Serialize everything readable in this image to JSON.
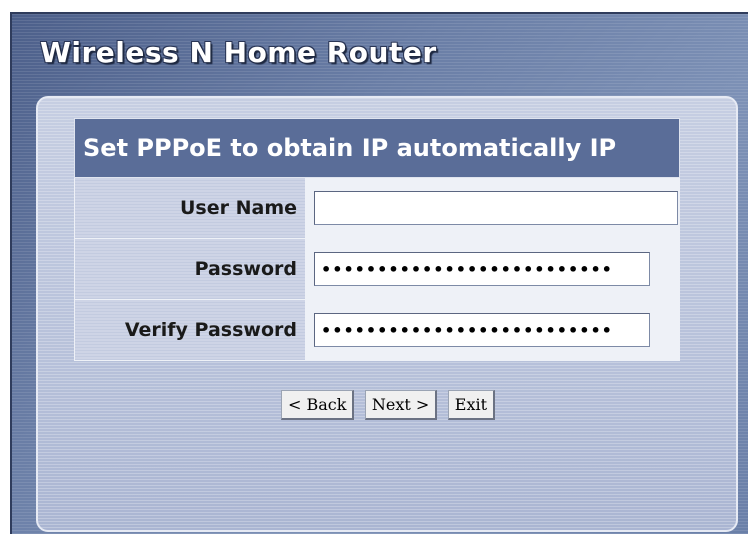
{
  "app": {
    "title": "Wireless N Home Router"
  },
  "form": {
    "heading": "Set PPPoE to obtain IP automatically IP",
    "fields": [
      {
        "label": "User Name",
        "value": "",
        "type": "text"
      },
      {
        "label": "Password",
        "value": "••••••••••••••••••••••••••",
        "type": "password"
      },
      {
        "label": "Verify Password",
        "value": "••••••••••••••••••••••••••",
        "type": "password"
      }
    ]
  },
  "buttons": {
    "back_label": "< Back",
    "next_label": "Next >",
    "exit_label": "Exit"
  },
  "colors": {
    "window_bg": "#6a7ea6",
    "panel_bg": "#b7c1da",
    "header_bg": "#5a6d98",
    "label_bg": "#c3cbe0",
    "field_bg": "#eef1f7"
  }
}
